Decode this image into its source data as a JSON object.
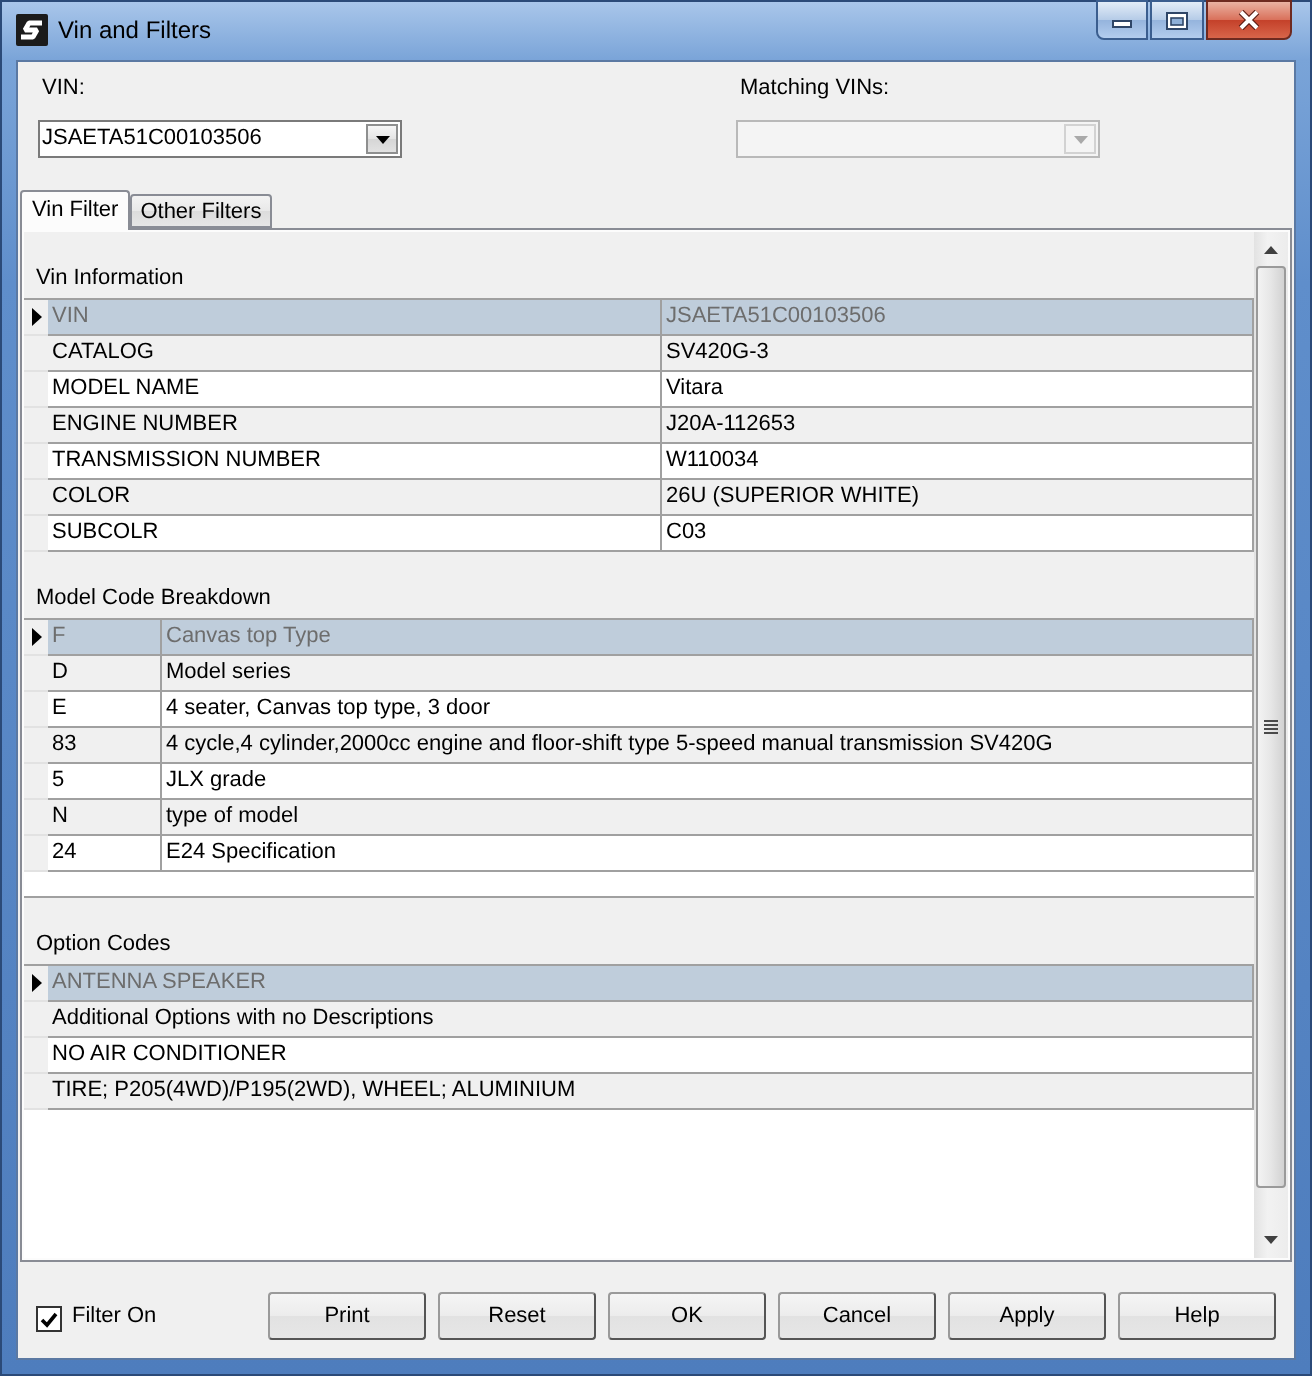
{
  "window": {
    "title": "Vin and Filters"
  },
  "vin": {
    "label": "VIN:",
    "value": "JSAETA51C00103506"
  },
  "matching_vins": {
    "label": "Matching VINs:",
    "disabled": true
  },
  "tabs": [
    {
      "label": "Vin Filter",
      "selected": true
    },
    {
      "label": "Other Filters",
      "selected": false
    }
  ],
  "sections": [
    {
      "kind": "properties",
      "title": "Vin Information",
      "rows": [
        {
          "cells": [
            "VIN",
            "JSAETA51C00103506"
          ],
          "selected": true
        },
        {
          "cells": [
            "CATALOG",
            "SV420G-3"
          ],
          "selected": false
        },
        {
          "cells": [
            "MODEL NAME",
            "Vitara"
          ],
          "selected": false
        },
        {
          "cells": [
            "ENGINE NUMBER",
            "J20A-112653"
          ],
          "selected": false
        },
        {
          "cells": [
            "TRANSMISSION NUMBER",
            "W110034"
          ],
          "selected": false
        },
        {
          "cells": [
            "COLOR",
            "26U (SUPERIOR WHITE)"
          ],
          "selected": false
        },
        {
          "cells": [
            "SUBCOLR",
            "C03"
          ],
          "selected": false
        }
      ]
    },
    {
      "kind": "codes",
      "title": "Model Code Breakdown",
      "rows": [
        {
          "cells": [
            "F",
            "Canvas top Type"
          ],
          "selected": true
        },
        {
          "cells": [
            "D",
            "Model series"
          ],
          "selected": false
        },
        {
          "cells": [
            "E",
            "4 seater, Canvas top type, 3 door"
          ],
          "selected": false
        },
        {
          "cells": [
            "83",
            "4 cycle,4 cylinder,2000cc engine and floor-shift type 5-speed manual transmission SV420G"
          ],
          "selected": false
        },
        {
          "cells": [
            "5",
            "JLX grade"
          ],
          "selected": false
        },
        {
          "cells": [
            "N",
            "type of model"
          ],
          "selected": false
        },
        {
          "cells": [
            "24",
            "E24 Specification"
          ],
          "selected": false
        }
      ]
    },
    {
      "kind": "list",
      "title": "Option Codes",
      "rows": [
        {
          "cells": [
            "ANTENNA SPEAKER"
          ],
          "selected": true
        },
        {
          "cells": [
            "Additional Options with no Descriptions"
          ],
          "selected": false
        },
        {
          "cells": [
            "NO AIR CONDITIONER"
          ],
          "selected": false
        },
        {
          "cells": [
            "TIRE; P205(4WD)/P195(2WD), WHEEL; ALUMINIUM"
          ],
          "selected": false
        }
      ]
    }
  ],
  "filter_on": {
    "label": "Filter On",
    "checked": true
  },
  "buttons": [
    "Print",
    "Reset",
    "OK",
    "Cancel",
    "Apply",
    "Help"
  ]
}
